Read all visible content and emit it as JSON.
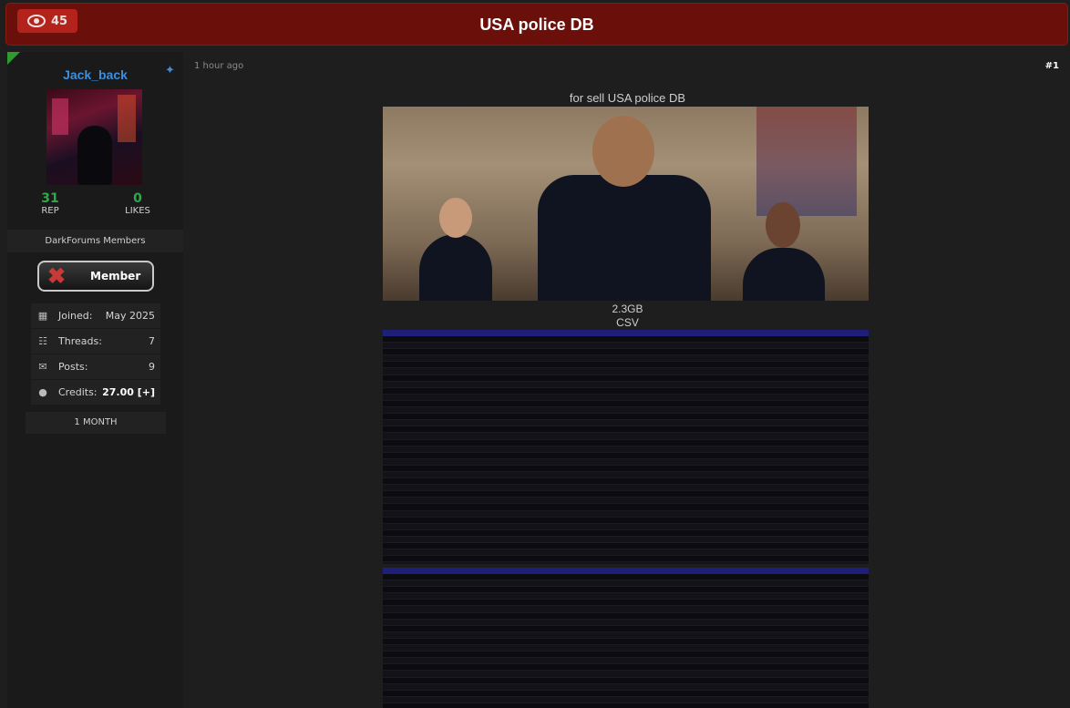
{
  "header": {
    "view_count": "45",
    "title": "USA police DB"
  },
  "user": {
    "username": "Jack_back",
    "rep_value": "31",
    "rep_label": "REP",
    "likes_value": "0",
    "likes_label": "LIKES",
    "group": "DarkForums Members",
    "badge_label": "Member",
    "info": [
      {
        "icon": "calendar-icon",
        "label": "Joined:",
        "value": "May 2025"
      },
      {
        "icon": "book-icon",
        "label": "Threads:",
        "value": "7"
      },
      {
        "icon": "comments-icon",
        "label": "Posts:",
        "value": "9"
      },
      {
        "icon": "coins-icon",
        "label": "Credits:",
        "value": "27.00 [+]"
      }
    ],
    "subscription": "1 MONTH"
  },
  "post": {
    "time": "1 hour ago",
    "number": "#1",
    "sell_text": "for sell USA police DB",
    "size": "2.3GB",
    "format": "CSV"
  },
  "colors": {
    "header_bg": "#6a0f0a",
    "views_bg": "#b3231b",
    "username": "#3e8ee0",
    "stat_value": "#2fa84a"
  }
}
